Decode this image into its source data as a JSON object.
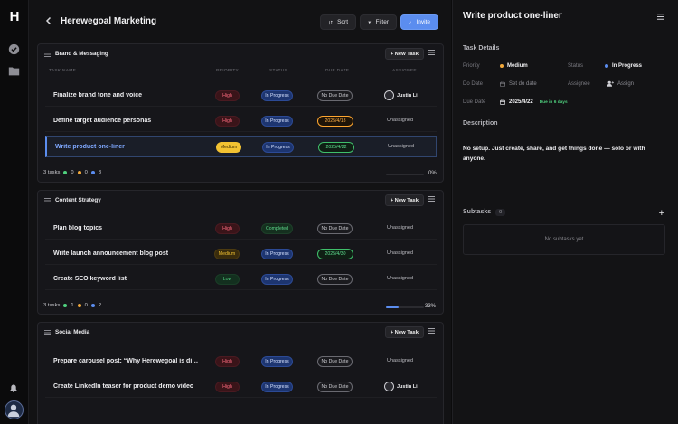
{
  "app": {
    "logo_letter": "H"
  },
  "header": {
    "project_title": "Herewegoal Marketing",
    "sort_label": "Sort",
    "filter_label": "Filter",
    "invite_label": "Invite"
  },
  "columns": {
    "task_name": "TASK NAME",
    "priority": "PRIORITY",
    "status": "STATUS",
    "due_date": "DUE DATE",
    "assignee": "ASSIGNEE"
  },
  "new_task_label": "+ New Task",
  "groups": [
    {
      "title": "Brand & Messaging",
      "tasks": [
        {
          "name": "Finalize brand tone and voice",
          "priority": "High",
          "status": "In Progress",
          "due": "No Due Date",
          "assignee": "Justin Li"
        },
        {
          "name": "Define target audience personas",
          "priority": "High",
          "status": "In Progress",
          "due": "2025/4/18",
          "assignee": "Unassigned"
        },
        {
          "name": "Write product one-liner",
          "priority": "Medium",
          "status": "In Progress",
          "due": "2025/4/22",
          "assignee": "Unassigned"
        }
      ],
      "footer": {
        "count": "3 tasks",
        "c_green": "0",
        "c_orange": "0",
        "c_blue": "3",
        "percent": "0%",
        "progress": 0.0
      }
    },
    {
      "title": "Content Strategy",
      "tasks": [
        {
          "name": "Plan blog topics",
          "priority": "High",
          "status": "Completed",
          "due": "No Due Date",
          "assignee": "Unassigned"
        },
        {
          "name": "Write launch announcement blog post",
          "priority": "Medium",
          "status": "In Progress",
          "due": "2025/4/30",
          "assignee": "Unassigned"
        },
        {
          "name": "Create SEO keyword list",
          "priority": "Low",
          "status": "In Progress",
          "due": "No Due Date",
          "assignee": "Unassigned"
        }
      ],
      "footer": {
        "count": "3 tasks",
        "c_green": "1",
        "c_orange": "0",
        "c_blue": "2",
        "percent": "33%",
        "progress": 0.33
      }
    },
    {
      "title": "Social Media",
      "tasks": [
        {
          "name": "Prepare carousel post: “Why Herewegoal is diff...",
          "priority": "High",
          "status": "In Progress",
          "due": "No Due Date",
          "assignee": "Unassigned"
        },
        {
          "name": "Create LinkedIn teaser for product demo video",
          "priority": "High",
          "status": "In Progress",
          "due": "No Due Date",
          "assignee": "Justin Li"
        }
      ]
    }
  ],
  "panel": {
    "title": "Write product one-liner",
    "task_details": "Task Details",
    "priority_label": "Priority",
    "priority_value": "Medium",
    "status_label": "Status",
    "status_value": "In Progress",
    "do_date_label": "Do Date",
    "do_date_value": "Set do date",
    "assignee_label": "Assignee",
    "assignee_value": "Assign",
    "due_date_label": "Due Date",
    "due_date_value": "2025/4/22",
    "due_relative": "Due in 6 days",
    "description_heading": "Description",
    "description_text": "No setup. Just create, share, and get things done — solo or with anyone.",
    "subtasks_heading": "Subtasks",
    "subtasks_count": "0",
    "subtasks_empty": "No subtasks yet",
    "add_symbol": "+"
  },
  "colors": {
    "accent": "#5b8def",
    "medium": "#f2c232",
    "high": "#ff6b80",
    "green": "#4fd07e"
  }
}
